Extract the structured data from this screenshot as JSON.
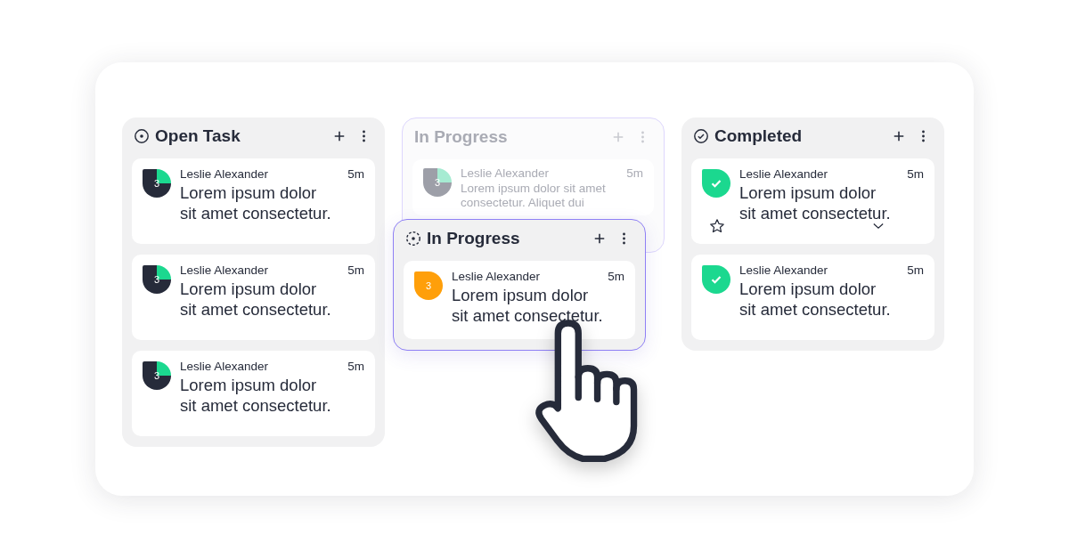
{
  "columns": [
    {
      "title": "Open Task",
      "kind": "open",
      "faded": false,
      "cards": [
        {
          "badge": "3",
          "kind": "pie",
          "author": "Leslie Alexander",
          "time": "5m",
          "text": "Lorem ipsum dolor\nsit amet consectetur.",
          "expanded": false
        },
        {
          "badge": "3",
          "kind": "pie",
          "author": "Leslie Alexander",
          "time": "5m",
          "text": "Lorem ipsum dolor\nsit amet consectetur.",
          "expanded": false
        },
        {
          "badge": "3",
          "kind": "pie",
          "author": "Leslie Alexander",
          "time": "5m",
          "text": "Lorem ipsum dolor\nsit amet consectetur.",
          "expanded": false
        }
      ]
    },
    {
      "title": "In Progress",
      "kind": "none",
      "faded": true,
      "cards": [
        {
          "badge": "3",
          "kind": "pie",
          "author": "Leslie Alexander",
          "time": "5m",
          "text": "Lorem ipsum dolor sit amet\nconsectetur. Aliquet dui",
          "expanded": false
        }
      ]
    },
    {
      "title": "Completed",
      "kind": "done",
      "faded": false,
      "cards": [
        {
          "kind": "check",
          "author": "Leslie Alexander",
          "time": "5m",
          "text": "Lorem ipsum dolor\nsit amet consectetur.",
          "expanded": true
        },
        {
          "kind": "check",
          "author": "Leslie Alexander",
          "time": "5m",
          "text": "Lorem ipsum dolor\nsit amet consectetur.",
          "expanded": false
        }
      ]
    }
  ],
  "dragged_column": {
    "title": "In Progress",
    "kind": "progress",
    "cards": [
      {
        "badge": "3",
        "kind": "orange",
        "author": "Leslie Alexander",
        "time": "5m",
        "text": "Lorem ipsum dolor\nsit amet consectetur."
      }
    ]
  }
}
